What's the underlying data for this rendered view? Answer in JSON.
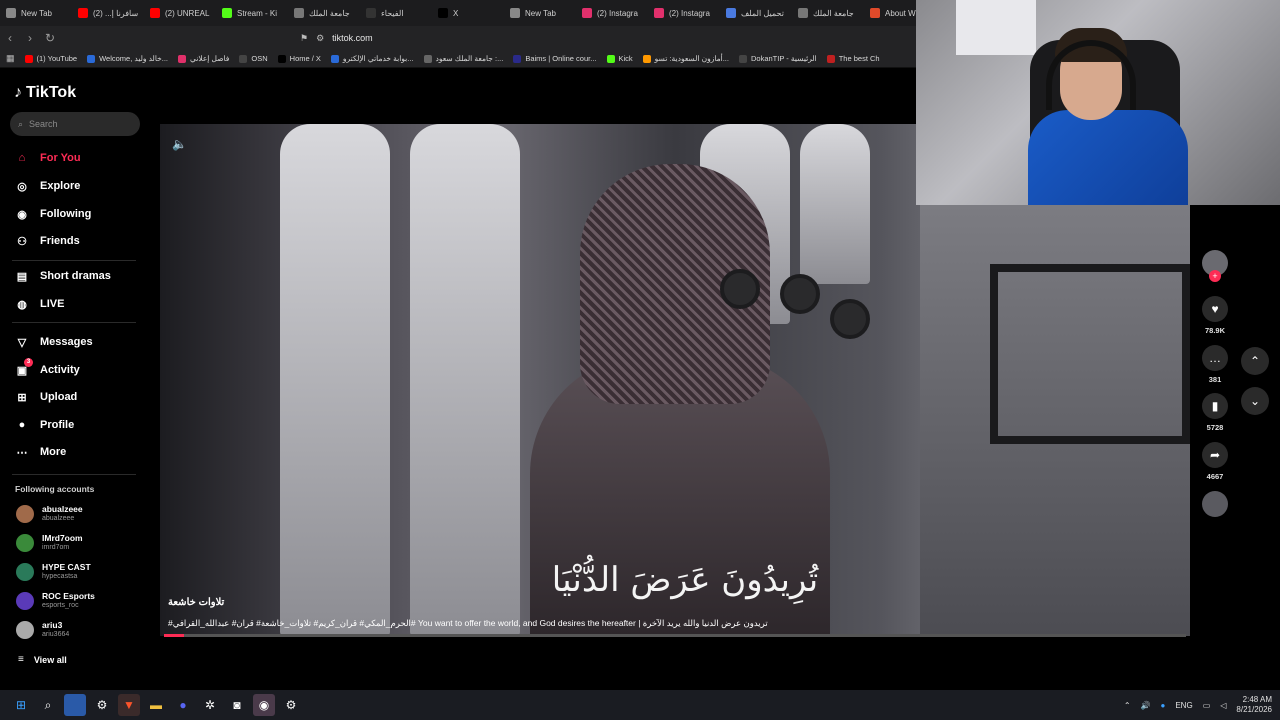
{
  "browser": {
    "tabs": [
      {
        "label": "New Tab",
        "color": "#888"
      },
      {
        "label": "سافرنا إ... (2)",
        "color": "#ff0000"
      },
      {
        "label": "(2) UNREAL",
        "color": "#ff0000"
      },
      {
        "label": "Stream - Ki",
        "color": "#53fc18"
      },
      {
        "label": "جامعة الملك",
        "color": "#777"
      },
      {
        "label": "الفيحاء",
        "color": "#333"
      },
      {
        "label": "X",
        "color": "#000"
      },
      {
        "label": "New Tab",
        "color": "#888"
      },
      {
        "label": "(2) Instagra",
        "color": "#e1306c"
      },
      {
        "label": "(2) Instagra",
        "color": "#e1306c"
      },
      {
        "label": "تحميل الملف",
        "color": "#4a7ae0"
      },
      {
        "label": "جامعة الملك",
        "color": "#777"
      },
      {
        "label": "About Whe",
        "color": "#e04a2a"
      }
    ],
    "url": "tiktok.com",
    "bookmarks": [
      {
        "label": "(1) YouTube",
        "color": "#ff0000"
      },
      {
        "label": "Welcome, خالد وليد...",
        "color": "#2a6ad8"
      },
      {
        "label": "فاصل إعلاني",
        "color": "#e0306a"
      },
      {
        "label": "OSN",
        "color": "#444"
      },
      {
        "label": "Home / X",
        "color": "#000"
      },
      {
        "label": "بوابة خدماتي الإلكترو...",
        "color": "#2a6ad8"
      },
      {
        "label": "جامعة الملك سعود :...",
        "color": "#666"
      },
      {
        "label": "Baims | Online cour...",
        "color": "#2a2a8a"
      },
      {
        "label": "Kick",
        "color": "#53fc18"
      },
      {
        "label": "أمازون السعودية: تسو...",
        "color": "#ff9900"
      },
      {
        "label": "DokanTIP - الرئيسية",
        "color": "#444"
      },
      {
        "label": "The best Ch",
        "color": "#c02020"
      }
    ]
  },
  "tiktok": {
    "logo": "TikTok",
    "search_placeholder": "Search",
    "nav": [
      {
        "label": "For You",
        "icon": "home-icon"
      },
      {
        "label": "Explore",
        "icon": "compass-icon"
      },
      {
        "label": "Following",
        "icon": "following-icon"
      },
      {
        "label": "Friends",
        "icon": "friends-icon"
      },
      {
        "label": "Short dramas",
        "icon": "dramas-icon"
      },
      {
        "label": "LIVE",
        "icon": "live-icon"
      },
      {
        "label": "Messages",
        "icon": "messages-icon"
      },
      {
        "label": "Activity",
        "icon": "activity-icon",
        "badge": "3"
      },
      {
        "label": "Upload",
        "icon": "upload-icon"
      },
      {
        "label": "Profile",
        "icon": "profile-icon"
      },
      {
        "label": "More",
        "icon": "more-icon"
      }
    ],
    "following_heading": "Following accounts",
    "accounts": [
      {
        "name": "abualzeee",
        "handle": "abualzeee",
        "color": "#a06a4a"
      },
      {
        "name": "IMrd7oom",
        "handle": "imrd7om",
        "color": "#3a8a3a"
      },
      {
        "name": "HYPE CAST",
        "handle": "hypecastsa",
        "color": "#2a7a5a"
      },
      {
        "name": "ROC Esports",
        "handle": "esports_roc",
        "color": "#5a3ab8"
      },
      {
        "name": "ariu3",
        "handle": "ariu3664",
        "color": "#aaaaaa"
      }
    ],
    "view_all": "View all"
  },
  "video": {
    "subtitle_arabic": "تُرِيدُونَ عَرَضَ الدُّنْيَا",
    "caption_title": "تلاوات خاشعة",
    "caption_desc": "#الحرم_المكي# قران_كريم# تلاوات_خاشعة# قران# عبدالله_القرافي# You want to offer the world, and God desires the hereafter | تريدون عرض الدنيا والله يريد الآخرة",
    "progress": 0.02
  },
  "actions": {
    "likes": "78.9K",
    "comments": "381",
    "saves": "5728",
    "shares": "4667"
  },
  "taskbar": {
    "language": "ENG",
    "time": "2:48 AM",
    "date": "8/21/2026"
  }
}
